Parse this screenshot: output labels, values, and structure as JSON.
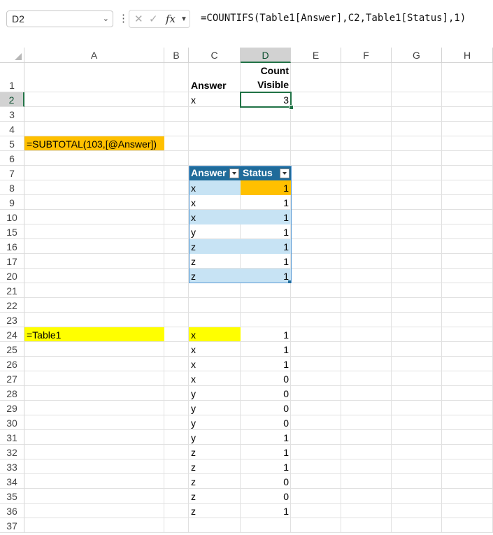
{
  "formula_bar": {
    "name_box": "D2",
    "formula": "=COUNTIFS(Table1[Answer],C2,Table1[Status],1)"
  },
  "columns": [
    "A",
    "B",
    "C",
    "D",
    "E",
    "F",
    "G",
    "H"
  ],
  "rows": [
    "1",
    "2",
    "3",
    "4",
    "5",
    "6",
    "7",
    "8",
    "9",
    "10",
    "15",
    "16",
    "17",
    "20",
    "21",
    "22",
    "23",
    "24",
    "25",
    "26",
    "27",
    "28",
    "29",
    "30",
    "31",
    "32",
    "33",
    "34",
    "35",
    "36",
    "37"
  ],
  "cells": {
    "c1": "Answer",
    "d1_line1": "Count",
    "d1_line2": "Visible",
    "c2": "x",
    "d2": "3",
    "a5": "=SUBTOTAL(103,[@Answer])",
    "a24": "=Table1"
  },
  "table1": {
    "headers": [
      "Answer",
      "Status"
    ],
    "rows": [
      {
        "answer": "x",
        "status": "1"
      },
      {
        "answer": "x",
        "status": "1"
      },
      {
        "answer": "x",
        "status": "1"
      },
      {
        "answer": "y",
        "status": "1"
      },
      {
        "answer": "z",
        "status": "1"
      },
      {
        "answer": "z",
        "status": "1"
      },
      {
        "answer": "z",
        "status": "1"
      }
    ]
  },
  "spill": [
    {
      "answer": "x",
      "status": "1"
    },
    {
      "answer": "x",
      "status": "1"
    },
    {
      "answer": "x",
      "status": "1"
    },
    {
      "answer": "x",
      "status": "0"
    },
    {
      "answer": "y",
      "status": "0"
    },
    {
      "answer": "y",
      "status": "0"
    },
    {
      "answer": "y",
      "status": "0"
    },
    {
      "answer": "y",
      "status": "1"
    },
    {
      "answer": "z",
      "status": "1"
    },
    {
      "answer": "z",
      "status": "1"
    },
    {
      "answer": "z",
      "status": "0"
    },
    {
      "answer": "z",
      "status": "0"
    },
    {
      "answer": "z",
      "status": "1"
    }
  ],
  "colors": {
    "selection_green": "#217346",
    "table_header": "#1f6b9a",
    "table_band": "#c7e3f4",
    "highlight_orange": "#ffc000",
    "highlight_yellow": "#ffff00"
  }
}
